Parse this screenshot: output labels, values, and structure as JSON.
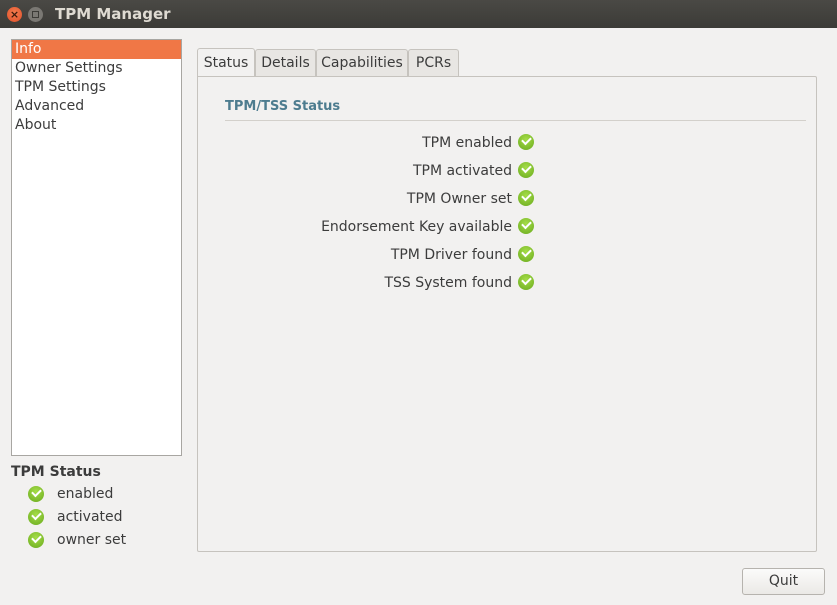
{
  "window": {
    "title": "TPM Manager"
  },
  "sidebar": {
    "items": [
      {
        "label": "Info",
        "selected": true
      },
      {
        "label": "Owner Settings",
        "selected": false
      },
      {
        "label": "TPM Settings",
        "selected": false
      },
      {
        "label": "Advanced",
        "selected": false
      },
      {
        "label": "About",
        "selected": false
      }
    ]
  },
  "tpm_status": {
    "title": "TPM Status",
    "items": [
      {
        "label": "enabled",
        "icon": "check-ok-icon"
      },
      {
        "label": "activated",
        "icon": "check-ok-icon"
      },
      {
        "label": "owner set",
        "icon": "check-ok-icon"
      }
    ]
  },
  "tabs": [
    {
      "label": "Status",
      "active": true
    },
    {
      "label": "Details",
      "active": false
    },
    {
      "label": "Capabilities",
      "active": false
    },
    {
      "label": "PCRs",
      "active": false
    }
  ],
  "status_panel": {
    "section_title": "TPM/TSS Status",
    "rows": [
      {
        "label": "TPM enabled",
        "icon": "check-ok-icon"
      },
      {
        "label": "TPM activated",
        "icon": "check-ok-icon"
      },
      {
        "label": "TPM Owner set",
        "icon": "check-ok-icon"
      },
      {
        "label": "Endorsement Key available",
        "icon": "check-ok-icon"
      },
      {
        "label": "TPM Driver found",
        "icon": "check-ok-icon"
      },
      {
        "label": "TSS System found",
        "icon": "check-ok-icon"
      }
    ]
  },
  "buttons": {
    "quit": "Quit"
  },
  "colors": {
    "selection": "#f07746",
    "ok": "#7dbd2a",
    "section_title": "#4d7c8f"
  }
}
